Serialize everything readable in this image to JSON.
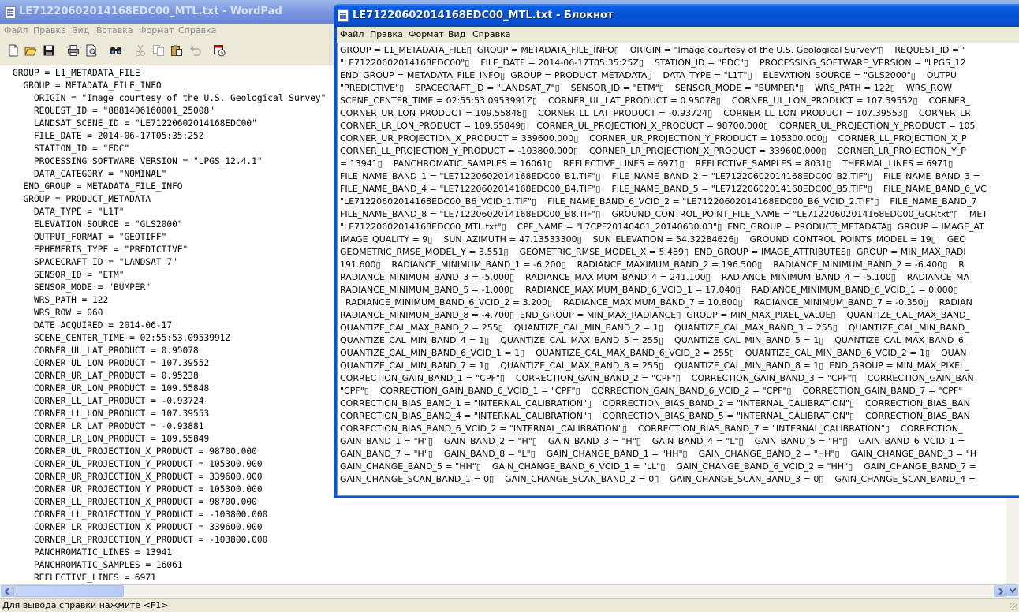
{
  "wordpad": {
    "title": "LE71220602014168EDC00_MTL.txt - WordPad",
    "menu": [
      "Файл",
      "Правка",
      "Вид",
      "Вставка",
      "Формат",
      "Справка"
    ],
    "toolbar_icons": [
      "new-icon",
      "open-icon",
      "save-icon",
      "print-icon",
      "print-preview-icon",
      "find-icon",
      "cut-icon",
      "copy-icon",
      "paste-icon",
      "undo-icon",
      "insert-datetime-icon"
    ],
    "lines": [
      "GROUP = L1_METADATA_FILE",
      "  GROUP = METADATA_FILE_INFO",
      "    ORIGIN = \"Image courtesy of the U.S. Geological Survey\"",
      "    REQUEST_ID = \"8881406160001_25008\"",
      "    LANDSAT_SCENE_ID = \"LE71220602014168EDC00\"",
      "    FILE_DATE = 2014-06-17T05:35:25Z",
      "    STATION_ID = \"EDC\"",
      "    PROCESSING_SOFTWARE_VERSION = \"LPGS_12.4.1\"",
      "    DATA_CATEGORY = \"NOMINAL\"",
      "  END_GROUP = METADATA_FILE_INFO",
      "  GROUP = PRODUCT_METADATA",
      "    DATA_TYPE = \"L1T\"",
      "    ELEVATION_SOURCE = \"GLS2000\"",
      "    OUTPUT_FORMAT = \"GEOTIFF\"",
      "    EPHEMERIS_TYPE = \"PREDICTIVE\"",
      "    SPACECRAFT_ID = \"LANDSAT_7\"",
      "    SENSOR_ID = \"ETM\"",
      "    SENSOR_MODE = \"BUMPER\"",
      "    WRS_PATH = 122",
      "    WRS_ROW = 060",
      "    DATE_ACQUIRED = 2014-06-17",
      "    SCENE_CENTER_TIME = 02:55:53.0953991Z",
      "    CORNER_UL_LAT_PRODUCT = 0.95078",
      "    CORNER_UL_LON_PRODUCT = 107.39552",
      "    CORNER_UR_LAT_PRODUCT = 0.95238",
      "    CORNER_UR_LON_PRODUCT = 109.55848",
      "    CORNER_LL_LAT_PRODUCT = -0.93724",
      "    CORNER_LL_LON_PRODUCT = 107.39553",
      "    CORNER_LR_LAT_PRODUCT = -0.93881",
      "    CORNER_LR_LON_PRODUCT = 109.55849",
      "    CORNER_UL_PROJECTION_X_PRODUCT = 98700.000",
      "    CORNER_UL_PROJECTION_Y_PRODUCT = 105300.000",
      "    CORNER_UR_PROJECTION_X_PRODUCT = 339600.000",
      "    CORNER_UR_PROJECTION_Y_PRODUCT = 105300.000",
      "    CORNER_LL_PROJECTION_X_PRODUCT = 98700.000",
      "    CORNER_LL_PROJECTION_Y_PRODUCT = -103800.000",
      "    CORNER_LR_PROJECTION_X_PRODUCT = 339600.000",
      "    CORNER_LR_PROJECTION_Y_PRODUCT = -103800.000",
      "    PANCHROMATIC_LINES = 13941",
      "    PANCHROMATIC_SAMPLES = 16061",
      "    REFLECTIVE_LINES = 6971"
    ],
    "status": "Для вывода справки нажмите <F1>"
  },
  "notepad": {
    "title": "LE71220602014168EDC00_MTL.txt - Блокнот",
    "menu": [
      "Файл",
      "Правка",
      "Формат",
      "Вид",
      "Справка"
    ],
    "lines": [
      "GROUP = L1_METADATA_FILE▯  GROUP = METADATA_FILE_INFO▯    ORIGIN = \"Image courtesy of the U.S. Geological Survey\"▯    REQUEST_ID = \"",
      "\"LE71220602014168EDC00\"▯    FILE_DATE = 2014-06-17T05:35:25Z▯    STATION_ID = \"EDC\"▯    PROCESSING_SOFTWARE_VERSION = \"LPGS_12",
      "END_GROUP = METADATA_FILE_INFO▯  GROUP = PRODUCT_METADATA▯    DATA_TYPE = \"L1T\"▯    ELEVATION_SOURCE = \"GLS2000\"▯    OUTPU",
      "\"PREDICTIVE\"▯    SPACECRAFT_ID = \"LANDSAT_7\"▯    SENSOR_ID = \"ETM\"▯    SENSOR_MODE = \"BUMPER\"▯    WRS_PATH = 122▯    WRS_ROW",
      "SCENE_CENTER_TIME = 02:55:53.0953991Z▯    CORNER_UL_LAT_PRODUCT = 0.95078▯    CORNER_UL_LON_PRODUCT = 107.39552▯    CORNER_",
      "CORNER_UR_LON_PRODUCT = 109.55848▯    CORNER_LL_LAT_PRODUCT = -0.93724▯    CORNER_LL_LON_PRODUCT = 107.39553▯    CORNER_LR",
      "CORNER_LR_LON_PRODUCT = 109.55849▯    CORNER_UL_PROJECTION_X_PRODUCT = 98700.000▯    CORNER_UL_PROJECTION_Y_PRODUCT = 105",
      "CORNER_UR_PROJECTION_X_PRODUCT = 339600.000▯    CORNER_UR_PROJECTION_Y_PRODUCT = 105300.000▯    CORNER_LL_PROJECTION_X_P",
      "CORNER_LL_PROJECTION_Y_PRODUCT = -103800.000▯    CORNER_LR_PROJECTION_X_PRODUCT = 339600.000▯    CORNER_LR_PROJECTION_Y_P",
      "= 13941▯    PANCHROMATIC_SAMPLES = 16061▯    REFLECTIVE_LINES = 6971▯    REFLECTIVE_SAMPLES = 8031▯    THERMAL_LINES = 6971▯",
      "FILE_NAME_BAND_1 = \"LE71220602014168EDC00_B1.TIF\"▯    FILE_NAME_BAND_2 = \"LE71220602014168EDC00_B2.TIF\"▯    FILE_NAME_BAND_3 =",
      "FILE_NAME_BAND_4 = \"LE71220602014168EDC00_B4.TIF\"▯    FILE_NAME_BAND_5 = \"LE71220602014168EDC00_B5.TIF\"▯    FILE_NAME_BAND_6_VC",
      "\"LE71220602014168EDC00_B6_VCID_1.TIF\"▯    FILE_NAME_BAND_6_VCID_2 = \"LE71220602014168EDC00_B6_VCID_2.TIF\"▯    FILE_NAME_BAND_7",
      "FILE_NAME_BAND_8 = \"LE71220602014168EDC00_B8.TIF\"▯    GROUND_CONTROL_POINT_FILE_NAME = \"LE71220602014168EDC00_GCP.txt\"▯    MET",
      "\"LE71220602014168EDC00_MTL.txt\"▯    CPF_NAME = \"L7CPF20140401_20140630.03\"▯  END_GROUP = PRODUCT_METADATA▯  GROUP = IMAGE_AT",
      "IMAGE_QUALITY = 9▯    SUN_AZIMUTH = 47.13533300▯    SUN_ELEVATION = 54.32284626▯    GROUND_CONTROL_POINTS_MODEL = 19▯    GEO",
      "GEOMETRIC_RMSE_MODEL_Y = 3.551▯    GEOMETRIC_RMSE_MODEL_X = 5.489▯  END_GROUP = IMAGE_ATTRIBUTES▯  GROUP = MIN_MAX_RADI",
      "191.600▯    RADIANCE_MINIMUM_BAND_1 = -6.200▯    RADIANCE_MAXIMUM_BAND_2 = 196.500▯    RADIANCE_MINIMUM_BAND_2 = -6.400▯    R",
      "RADIANCE_MINIMUM_BAND_3 = -5.000▯    RADIANCE_MAXIMUM_BAND_4 = 241.100▯    RADIANCE_MINIMUM_BAND_4 = -5.100▯    RADIANCE_MA",
      "RADIANCE_MINIMUM_BAND_5 = -1.000▯    RADIANCE_MAXIMUM_BAND_6_VCID_1 = 17.040▯    RADIANCE_MINIMUM_BAND_6_VCID_1 = 0.000▯",
      "  RADIANCE_MINIMUM_BAND_6_VCID_2 = 3.200▯    RADIANCE_MAXIMUM_BAND_7 = 10.800▯    RADIANCE_MINIMUM_BAND_7 = -0.350▯    RADIAN",
      "RADIANCE_MINIMUM_BAND_8 = -4.700▯  END_GROUP = MIN_MAX_RADIANCE▯  GROUP = MIN_MAX_PIXEL_VALUE▯    QUANTIZE_CAL_MAX_BAND_",
      "QUANTIZE_CAL_MAX_BAND_2 = 255▯    QUANTIZE_CAL_MIN_BAND_2 = 1▯    QUANTIZE_CAL_MAX_BAND_3 = 255▯    QUANTIZE_CAL_MIN_BAND_",
      "QUANTIZE_CAL_MIN_BAND_4 = 1▯    QUANTIZE_CAL_MAX_BAND_5 = 255▯    QUANTIZE_CAL_MIN_BAND_5 = 1▯    QUANTIZE_CAL_MAX_BAND_6_",
      "QUANTIZE_CAL_MIN_BAND_6_VCID_1 = 1▯    QUANTIZE_CAL_MAX_BAND_6_VCID_2 = 255▯    QUANTIZE_CAL_MIN_BAND_6_VCID_2 = 1▯    QUAN",
      "QUANTIZE_CAL_MIN_BAND_7 = 1▯    QUANTIZE_CAL_MAX_BAND_8 = 255▯    QUANTIZE_CAL_MIN_BAND_8 = 1▯  END_GROUP = MIN_MAX_PIXEL_",
      "CORRECTION_GAIN_BAND_1 = \"CPF\"▯    CORRECTION_GAIN_BAND_2 = \"CPF\"▯    CORRECTION_GAIN_BAND_3 = \"CPF\"▯    CORRECTION_GAIN_BAN",
      "\"CPF\"▯    CORRECTION_GAIN_BAND_6_VCID_1 = \"CPF\"▯    CORRECTION_GAIN_BAND_6_VCID_2 = \"CPF\"▯    CORRECTION_GAIN_BAND_7 = \"CPF\"",
      "CORRECTION_BIAS_BAND_1 = \"INTERNAL_CALIBRATION\"▯    CORRECTION_BIAS_BAND_2 = \"INTERNAL_CALIBRATION\"▯    CORRECTION_BIAS_BAN",
      "CORRECTION_BIAS_BAND_4 = \"INTERNAL_CALIBRATION\"▯    CORRECTION_BIAS_BAND_5 = \"INTERNAL_CALIBRATION\"▯    CORRECTION_BIAS_BAN",
      "CORRECTION_BIAS_BAND_6_VCID_2 = \"INTERNAL_CALIBRATION\"▯    CORRECTION_BIAS_BAND_7 = \"INTERNAL_CALIBRATION\"▯    CORRECTION_",
      "GAIN_BAND_1 = \"H\"▯    GAIN_BAND_2 = \"H\"▯    GAIN_BAND_3 = \"H\"▯    GAIN_BAND_4 = \"L\"▯    GAIN_BAND_5 = \"H\"▯    GAIN_BAND_6_VCID_1 =",
      "GAIN_BAND_7 = \"H\"▯    GAIN_BAND_8 = \"L\"▯    GAIN_CHANGE_BAND_1 = \"HH\"▯    GAIN_CHANGE_BAND_2 = \"HH\"▯    GAIN_CHANGE_BAND_3 = \"H",
      "GAIN_CHANGE_BAND_5 = \"HH\"▯    GAIN_CHANGE_BAND_6_VCID_1 = \"LL\"▯    GAIN_CHANGE_BAND_6_VCID_2 = \"HH\"▯    GAIN_CHANGE_BAND_7 =",
      "GAIN_CHANGE_SCAN_BAND_1 = 0▯    GAIN_CHANGE_SCAN_BAND_2 = 0▯    GAIN_CHANGE_SCAN_BAND_3 = 0▯    GAIN_CHANGE_SCAN_BAND_4 ="
    ]
  }
}
